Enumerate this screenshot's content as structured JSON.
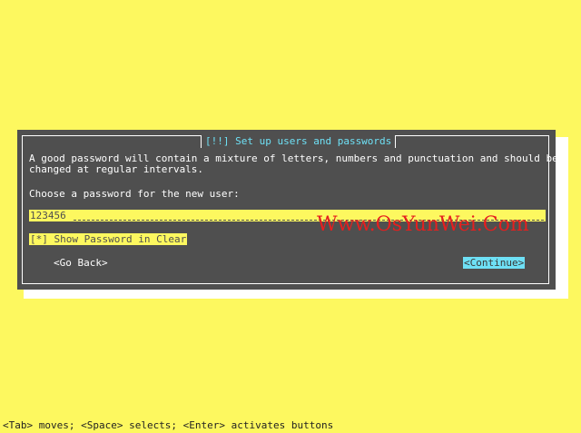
{
  "dialog": {
    "title": "[!!] Set up users and passwords",
    "description_line1": "A good password will contain a mixture of letters, numbers and punctuation and should be",
    "description_line2": "changed at regular intervals.",
    "prompt": "Choose a password for the new user:",
    "password_value": "123456",
    "show_password_checkbox": "[*] Show Password in Clear",
    "show_password_checked": true,
    "go_back_label": "<Go Back>",
    "continue_label": "<Continue>"
  },
  "watermark": "Www.OsYunWei.Com",
  "status_bar": "<Tab> moves; <Space> selects; <Enter> activates buttons",
  "colors": {
    "background": "#fdf85f",
    "dialog": "#4f4f4f",
    "accent": "#6ee0f5",
    "watermark": "#e51f1f"
  }
}
